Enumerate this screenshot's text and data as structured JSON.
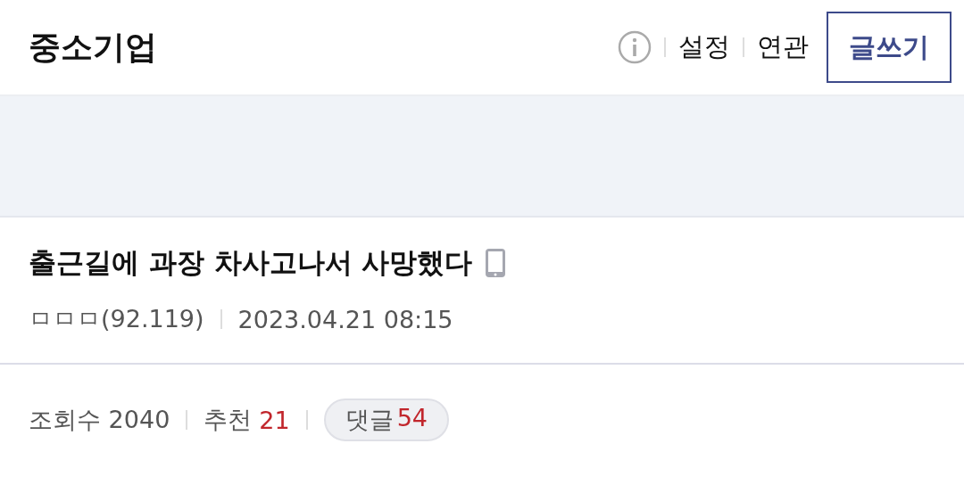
{
  "header": {
    "title": "중소기업",
    "links": [
      "설정",
      "연관"
    ],
    "write_button": "글쓰기"
  },
  "post": {
    "title": "출근길에 과장 차사고나서 사망했다",
    "from_mobile": true,
    "author": "ㅁㅁㅁ(92.119)",
    "date": "2023.04.21 08:15"
  },
  "stats": {
    "views_label": "조회수",
    "views": "2040",
    "recommend_label": "추천",
    "recommend": "21",
    "comments_label": "댓글",
    "comments": "54"
  }
}
